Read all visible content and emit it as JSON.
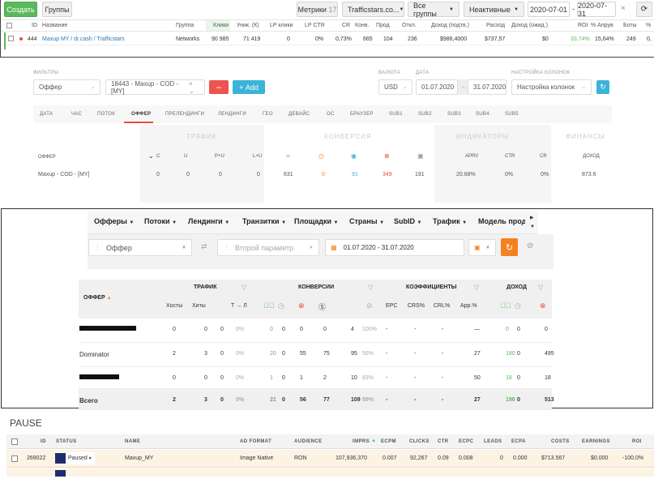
{
  "top": {
    "create_label": "Создать",
    "groups_label": "Группы",
    "metrics_label": "Метрики",
    "metrics_count": "17",
    "source_select": "Trafficstars.co...",
    "all_groups_select": "Все группы",
    "inactive_select": "Неактивные",
    "date_from": "2020-07-01",
    "date_sep": "-",
    "date_to": "2020-07-31",
    "headers": [
      "ID",
      "Название",
      "Группа",
      "Клики",
      "Уник. (К)",
      "LP клики",
      "LP CTR",
      "CR",
      "Конв.",
      "Прод",
      "Откл.",
      "Доход (подтв.)",
      "Расход",
      "Доход (ожид.)",
      "ROI",
      "% Апрув",
      "Боты",
      "%"
    ],
    "row": {
      "id": "444",
      "name": "Maxup MY / dr.cash / Trafficstars",
      "group": "Networks",
      "clicks": "90 985",
      "uniq": "71 419",
      "lp_clicks": "0",
      "lp_ctr": "0%",
      "cr": "0,73%",
      "conv": "665",
      "prod": "104",
      "rej": "236",
      "income_conf": "$986,4000",
      "expense": "$737,57",
      "income_exp": "$0",
      "roi": "33,74%",
      "approve": "15,64%",
      "bots": "249",
      "pct": "0,"
    }
  },
  "filters": {
    "filters_label": "ФИЛЬТРЫ",
    "offer_select": "Оффер",
    "campaign_select": "18443 - Maxup - COD - [MY]",
    "add_label": "Add",
    "currency_label": "ВАЛЮТА",
    "currency": "USD",
    "date_label": "ДАТА",
    "date_from": "01.07.2020",
    "date_to": "31.07.2020",
    "columns_label": "НАСТРОЙКА КОЛОНОК",
    "columns_select": "Настройка колонок",
    "tabs": [
      "ДАТА",
      "ЧАС",
      "ПОТОК",
      "ОФФЕР",
      "ПРЕЛЕНДИНГИ",
      "ЛЕНДИНГИ",
      "ГЕО",
      "ДЕВАЙС",
      "ОС",
      "БРАУЗЕР",
      "SUB1",
      "SUB2",
      "SUB3",
      "SUB4",
      "SUB5"
    ],
    "sections": [
      "ТРАФИК",
      "КОНВЕРСИЯ",
      "ИНДИКАТОРЫ",
      "ФИНАНСЫ"
    ],
    "col_offer": "ОФФЕР",
    "col_heads": [
      "С",
      "U",
      "P+U",
      "L+U",
      "",
      "",
      "",
      "",
      "",
      "APRV",
      "CTR",
      "CR",
      "ДОХОД"
    ],
    "row": {
      "offer": "Maxup - COD - [MY]",
      "c": "0",
      "u": "0",
      "pu": "0",
      "lu": "0",
      "conv1": "631",
      "conv2": "0",
      "conv3": "91",
      "conv4": "349",
      "conv5": "191",
      "aprv": "20.68%",
      "ctr": "0%",
      "cr": "0%",
      "income": "873.6"
    }
  },
  "stats": {
    "nav": [
      "Офферы",
      "Потоки",
      "Лендинги",
      "Транзитки",
      "Площадки",
      "Страны",
      "SubID",
      "Трафик",
      "Модель продаж"
    ],
    "first_param": "Оффер",
    "second_param": "Второй параметр",
    "date_range": "01.07.2020 - 31.07.2020",
    "groups": [
      "ТРАФИК",
      "КОНВЕРСИИ",
      "КОЭФФИЦИЕНТЫ",
      "ДОХОД"
    ],
    "offer_col": "ОФФЕР",
    "sub_heads": [
      "Хосты",
      "Хиты",
      "Т → Л",
      "EPC",
      "CRS%",
      "CRL%",
      "App.%"
    ],
    "rows": [
      {
        "name": "",
        "v": [
          "0",
          "0",
          "0",
          "0%",
          "0",
          "0",
          "0",
          "0",
          "4",
          "100%",
          "-",
          "-",
          "-",
          "—",
          "0",
          "0",
          "0"
        ]
      },
      {
        "name": "Dominator",
        "v": [
          "2",
          "3",
          "0",
          "0%",
          "20",
          "0",
          "55",
          "75",
          "95",
          "56%",
          "-",
          "-",
          "-",
          "27",
          "180",
          "0",
          "495"
        ]
      },
      {
        "name": "",
        "v": [
          "0",
          "0",
          "0",
          "0%",
          "1",
          "0",
          "1",
          "2",
          "10",
          "83%",
          "-",
          "-",
          "-",
          "50",
          "18",
          "0",
          "18"
        ]
      },
      {
        "name": "Всего",
        "v": [
          "2",
          "3",
          "0",
          "0%",
          "21",
          "0",
          "56",
          "77",
          "109",
          "59%",
          "-",
          "-",
          "-",
          "27",
          "198",
          "0",
          "513"
        ]
      }
    ]
  },
  "pause": {
    "title": "PAUSE",
    "headers": [
      "ID",
      "STATUS",
      "NAME",
      "AD FORMAT",
      "AUDIENCE",
      "IMPRS",
      "ECPM",
      "CLICKS",
      "CTR",
      "ECPC",
      "LEADS",
      "ECPA",
      "COSTS",
      "EARNINGS",
      "ROI"
    ],
    "row": {
      "id": "269022",
      "status": "Paused",
      "name": "Maxup_MY",
      "format": "Image Native",
      "audience": "RON",
      "imprs": "107,936,370",
      "ecpm": "0.007",
      "clicks": "92,267",
      "ctr": "0.09",
      "ecpc": "0.008",
      "leads": "0",
      "ecpa": "0.000",
      "costs": "$713.567",
      "earnings": "$0.000",
      "roi": "-100.0%"
    }
  },
  "colors": {
    "green": "#5cb85c",
    "red": "#e74c3c",
    "blue": "#3bb4d8",
    "orange": "#f58220",
    "pale": "#fdf3e4"
  }
}
